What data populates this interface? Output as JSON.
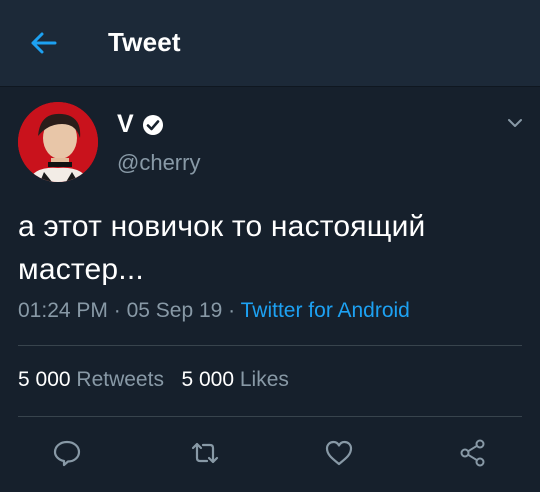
{
  "header": {
    "title": "Tweet",
    "back_icon": "arrow-left-icon",
    "accent": "#1da1f2"
  },
  "tweet": {
    "author_name": "V",
    "handle": "@cherry",
    "text_line1": "а этот новичок то настоящий",
    "text_line2": "мастер...",
    "time": "01:24 PM",
    "date": "05 Sep 19",
    "source": "Twitter for Android"
  },
  "stats": {
    "retweets_count": "5 000",
    "retweets_label": "Retweets",
    "likes_count": "5 000",
    "likes_label": "Likes"
  },
  "actions": [
    "reply-icon",
    "retweet-icon",
    "like-icon",
    "share-icon"
  ],
  "colors": {
    "background": "#16202c",
    "header": "#1c2938",
    "secondary_text": "#8899a6",
    "link": "#1da1f2"
  }
}
